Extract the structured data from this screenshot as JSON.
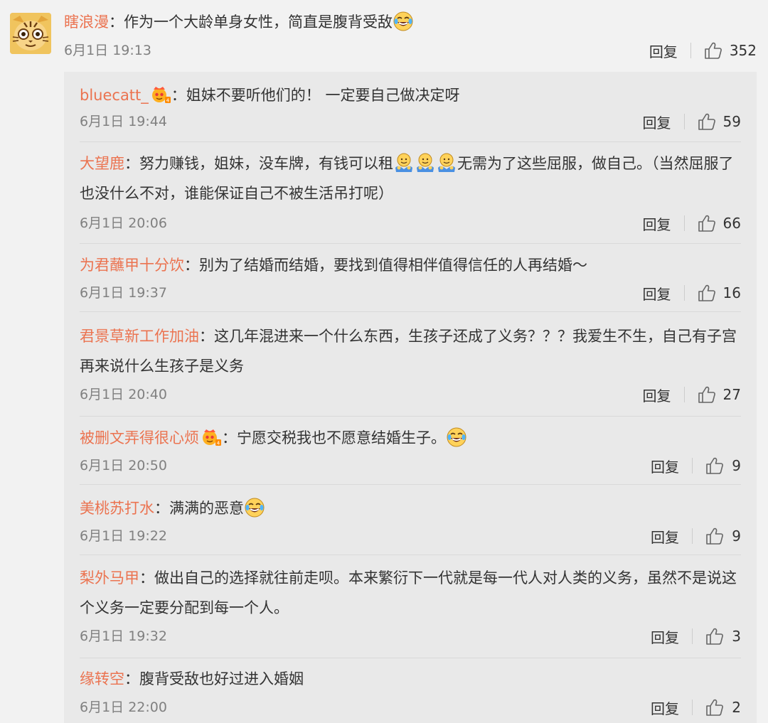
{
  "top": {
    "user": "瞎浪漫",
    "sep": "：",
    "text": "作为一个大龄单身女性，简直是腹背受敌",
    "time": "6月1日 19:13",
    "reply_label": "回复",
    "likes": "352"
  },
  "replies": [
    {
      "user": "bluecatt_",
      "sep": "：",
      "text": "姐妹不要听他们的！ 一定要自己做决定呀",
      "time": "6月1日 19:44",
      "reply_label": "回复",
      "likes": "59"
    },
    {
      "user": "大望鹿",
      "sep": "：",
      "text": "努力赚钱，姐妹，没车牌，有钱可以租",
      "text2": "无需为了这些屈服，做自己。（当然屈服了也没什么不对，谁能保证自己不被生活吊打呢）",
      "time": "6月1日 20:06",
      "reply_label": "回复",
      "likes": "66"
    },
    {
      "user": "为君蘸甲十分饮",
      "sep": "：",
      "text": "别为了结婚而结婚，要找到值得相伴值得信任的人再结婚～",
      "time": "6月1日 19:37",
      "reply_label": "回复",
      "likes": "16"
    },
    {
      "user": "君景草新工作加油",
      "sep": "：",
      "text": "这几年混进来一个什么东西，生孩子还成了义务？？？我爱生不生，自己有子宫再来说什么生孩子是义务",
      "time": "6月1日 20:40",
      "reply_label": "回复",
      "likes": "27"
    },
    {
      "user": "被删文弄得很心烦",
      "sep": "：",
      "text": "宁愿交税我也不愿意结婚生子。",
      "time": "6月1日 20:50",
      "reply_label": "回复",
      "likes": "9"
    },
    {
      "user": "美桃苏打水",
      "sep": "：",
      "text": "满满的恶意",
      "time": "6月1日 19:22",
      "reply_label": "回复",
      "likes": "9"
    },
    {
      "user": "梨外马甲",
      "sep": "：",
      "text": "做出自己的选择就往前走呗。本来繁衍下一代就是每一代人对人类的义务，虽然不是说这个义务一定要分配到每一个人。",
      "time": "6月1日 19:32",
      "reply_label": "回复",
      "likes": "3"
    },
    {
      "user": "缘转空",
      "sep": "：",
      "text": "腹背受敌也好过进入婚姻",
      "time": "6月1日 22:00",
      "reply_label": "回复",
      "likes": "2"
    }
  ],
  "colors": {
    "username": "#eb7350",
    "text": "#333333",
    "time": "#808080",
    "bg": "#f2f2f2",
    "reply_bg": "#e9e9e9"
  },
  "icons": {
    "like": "thumbs-up-icon",
    "laugh": "laughing-tears-emoji",
    "hug": "hug-emoji",
    "badge": "member-crown-badge"
  }
}
